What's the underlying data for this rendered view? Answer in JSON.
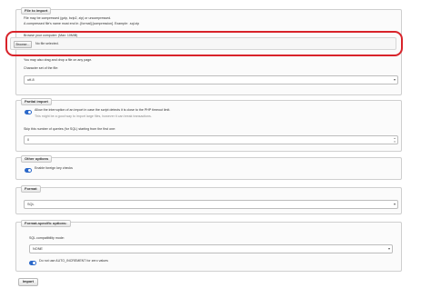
{
  "file_to_import": {
    "legend": "File to import",
    "line1": "File may be compressed (gzip, bzip2, zip) or uncompressed.",
    "line2": "A compressed file's name must end in .[format].[compression]. Example: .sql.zip",
    "choose_label": "Browse your computer: (Max: 10MiB)",
    "browse_button": "Browse...",
    "no_file_text": "No file selected.",
    "drag_text": "You may also drag and drop a file on any page.",
    "charset_label": "Character set of the file:",
    "charset_value": "utf-8"
  },
  "partial_import": {
    "legend": "Partial import",
    "allow_interrupt_label": "Allow the interruption of an import in case the script detects it is close to the PHP timeout limit.",
    "allow_interrupt_note": "This might be a good way to import large files, however it can break transactions.",
    "allow_interrupt_checked": true,
    "skip_label": "Skip this number of queries (for SQL) starting from the first one:",
    "skip_value": "0"
  },
  "other_options": {
    "legend": "Other options",
    "foreign_key_label": "Enable foreign key checks",
    "foreign_key_checked": true
  },
  "format": {
    "legend": "Format",
    "value": "SQL"
  },
  "format_specific": {
    "legend": "Format-specific options:",
    "compat_label": "SQL compatibility mode:",
    "compat_value": "NONE",
    "auto_inc_label": "Do not use AUTO_INCREMENT for zero values",
    "auto_inc_checked": true
  },
  "import_button": "Import",
  "colors": {
    "accent": "#2b68c9",
    "highlight": "#d8232a"
  }
}
